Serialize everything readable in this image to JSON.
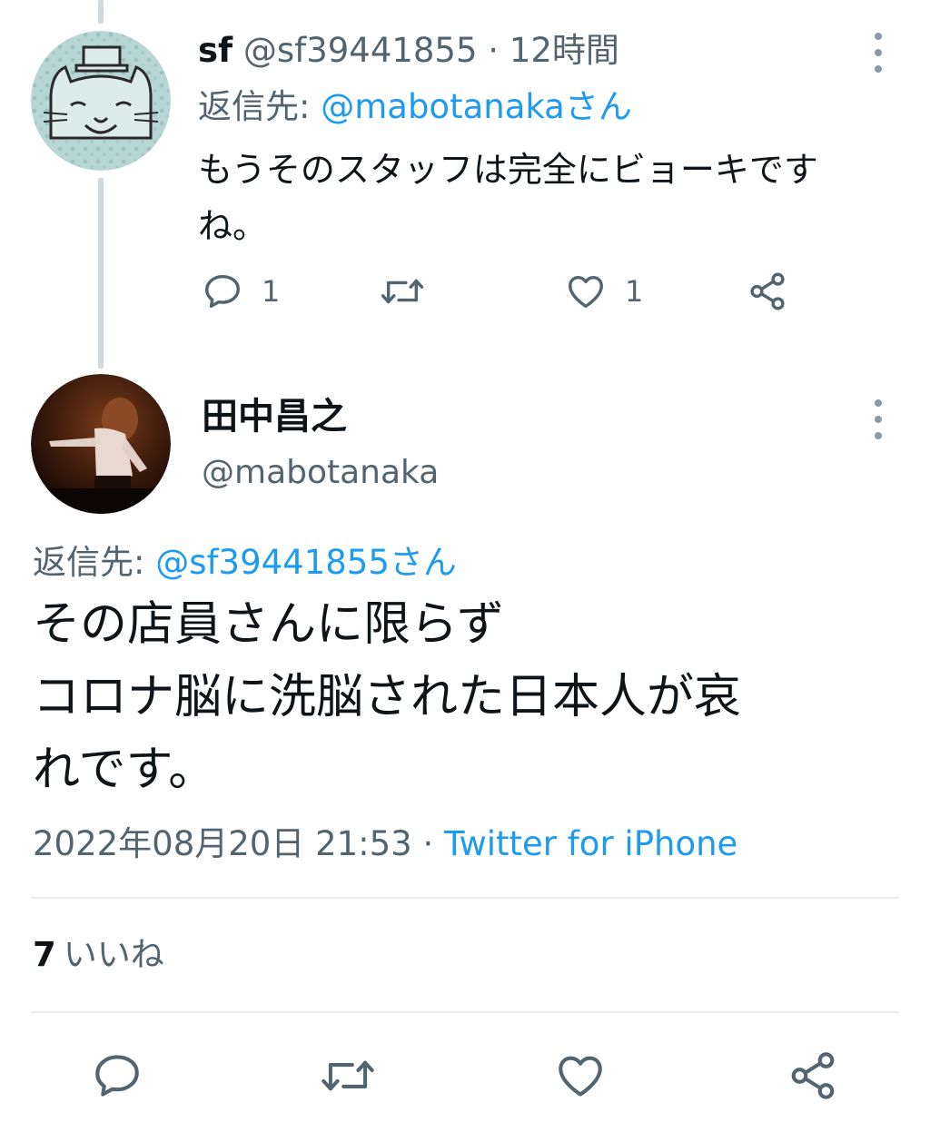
{
  "reply": {
    "name": "sf",
    "handle": "@sf39441855",
    "separator": "·",
    "time": "12時間",
    "replying_to_label": "返信先:",
    "replying_to_mention": "@mabotanakaさん",
    "text_line1": "もうそのスタッフは完全にビョーキです",
    "text_line2": "ね。",
    "reply_count": "1",
    "like_count": "1",
    "avatar_icon": "cat-with-hat-avatar"
  },
  "main": {
    "name": "田中昌之",
    "handle": "@mabotanaka",
    "replying_to_label": "返信先:",
    "replying_to_mention": "@sf39441855さん",
    "text_lines": [
      "その店員さんに限らず",
      "コロナ脳に洗脳された日本人が哀",
      "れです。"
    ],
    "timestamp": "2022年08月20日 21:53",
    "separator": "·",
    "source": "Twitter for iPhone",
    "likes_count": "7",
    "likes_label": "いいね",
    "avatar_icon": "performer-photo-avatar"
  },
  "colors": {
    "text_primary": "#0f1419",
    "text_secondary": "#536471",
    "link": "#1d9bf0",
    "divider": "#e6ecf0"
  },
  "icons": {
    "reply": "speech-bubble-icon",
    "retweet": "retweet-icon",
    "like": "heart-icon",
    "share": "share-icon",
    "more": "more-vertical-icon"
  }
}
